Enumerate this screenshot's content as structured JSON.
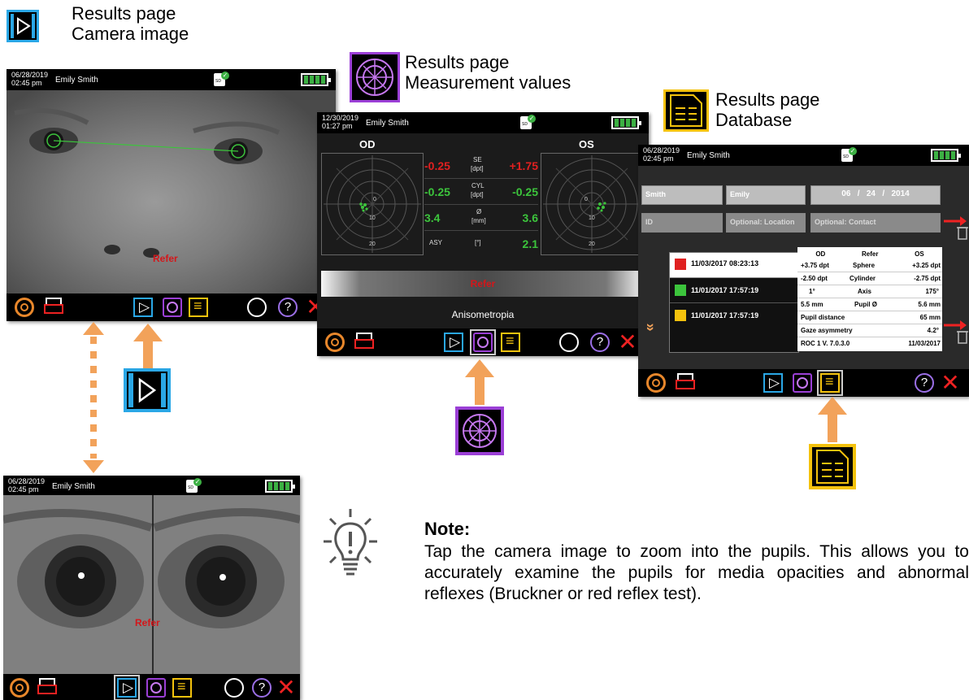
{
  "captions": {
    "camera": [
      "Results page",
      "Camera image"
    ],
    "measurement": [
      "Results page",
      "Measurement values"
    ],
    "database": [
      "Results page",
      "Database"
    ]
  },
  "screen1": {
    "date": "06/28/2019",
    "time": "02:45 pm",
    "patient": "Emily Smith",
    "result": "Refer"
  },
  "screen2": {
    "date": "12/30/2019",
    "time": "01:27 pm",
    "patient": "Emily Smith",
    "od": "OD",
    "os": "OS",
    "rows": [
      {
        "left": "-0.25",
        "label": "SE",
        "unit": "[dpt]",
        "right": "+1.75",
        "lcolor": "#e02020",
        "rcolor": "#e02020"
      },
      {
        "left": "-0.25",
        "label": "CYL",
        "unit": "[dpt]",
        "right": "-0.25",
        "lcolor": "#3cc43c",
        "rcolor": "#3cc43c"
      },
      {
        "left": "3.4",
        "label": "Ø",
        "unit": "[mm]",
        "right": "3.6",
        "lcolor": "#3cc43c",
        "rcolor": "#3cc43c"
      },
      {
        "left": "",
        "label": "ASY",
        "unit": "[°]",
        "right": "2.1",
        "lcolor": "#3cc43c",
        "rcolor": "#3cc43c"
      }
    ],
    "polar_ticks": [
      "0",
      "10",
      "20"
    ],
    "result": "Refer",
    "diagnosis": "Anisometropia"
  },
  "screen3": {
    "date": "06/28/2019",
    "time": "02:45 pm",
    "patient": "Emily Smith",
    "last_name": "Smith",
    "first_name": "Emily",
    "dob_month": "06",
    "dob_day": "24",
    "dob_year": "2014",
    "dob_sep": "/",
    "id_placeholder": "ID",
    "location_placeholder": "Optional: Location",
    "contact_placeholder": "Optional: Contact",
    "records": [
      {
        "timestamp": "11/03/2017 08:23:13",
        "color": "#e02020"
      },
      {
        "timestamp": "11/01/2017 17:57:19",
        "color": "#3cc43c"
      },
      {
        "timestamp": "11/01/2017 17:57:19",
        "color": "#f4c20d"
      }
    ],
    "detail_header": [
      "OD",
      "Refer",
      "OS"
    ],
    "detail_rows": [
      [
        "+3.75 dpt",
        "Sphere",
        "+3.25  dpt"
      ],
      [
        "-2.50 dpt",
        "Cylinder",
        "-2.75  dpt"
      ],
      [
        "1°",
        "Axis",
        "175°"
      ],
      [
        "5.5   mm",
        "Pupil Ø",
        "5.6  mm"
      ],
      [
        "Pupil distance",
        "",
        "65  mm"
      ],
      [
        "Gaze asymmetry",
        "",
        "4.2°"
      ],
      [
        "ROC 1   V. 7.0.3.0",
        "",
        "11/03/2017"
      ]
    ]
  },
  "screen4": {
    "date": "06/28/2019",
    "time": "02:45 pm",
    "patient": "Emily Smith",
    "result": "Refer"
  },
  "note": {
    "title": "Note:",
    "body": "Tap the camera image to zoom into the pupils. This allows you to accurately examine the pupils for media opacities and abnormal reflexes (Bruckner or red reflex test)."
  },
  "colors": {
    "accent_orange": "#f2a25a",
    "refer_red": "#d4161a",
    "ok_green": "#3cc43c",
    "camera_blue": "#2aa7e6",
    "measure_purple": "#9b3fd6",
    "database_yellow": "#f4c20d"
  },
  "icons": [
    "camera-image-icon",
    "measurement-values-icon",
    "database-icon",
    "settings-gear-icon",
    "printer-icon",
    "go-icon",
    "help-icon",
    "close-icon",
    "lightbulb-icon",
    "sd-card-icon",
    "battery-icon"
  ]
}
